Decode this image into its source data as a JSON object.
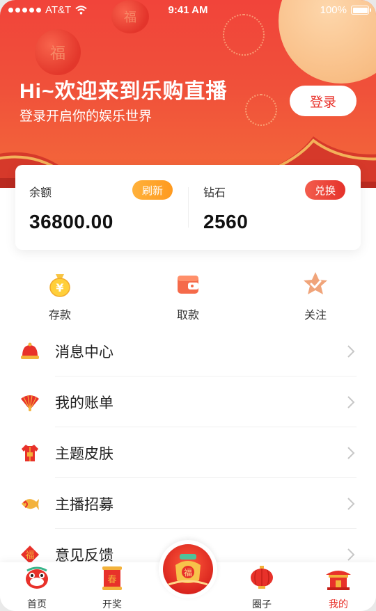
{
  "status_bar": {
    "carrier": "AT&T",
    "time": "9:41 AM",
    "battery": "100%"
  },
  "header": {
    "welcome": "Hi~欢迎来到乐购直播",
    "subtitle": "登录开启你的娱乐世界",
    "login_label": "登录"
  },
  "balance_card": {
    "balance": {
      "label": "余额",
      "value": "36800.00",
      "action": "刷新"
    },
    "diamond": {
      "label": "钻石",
      "value": "2560",
      "action": "兑换"
    }
  },
  "quick_actions": [
    {
      "label": "存款",
      "icon": "money-bag-icon"
    },
    {
      "label": "取款",
      "icon": "wallet-icon"
    },
    {
      "label": "关注",
      "icon": "star-icon"
    }
  ],
  "menu": [
    {
      "label": "消息中心",
      "icon": "helmet-icon"
    },
    {
      "label": "我的账单",
      "icon": "fan-icon"
    },
    {
      "label": "主题皮肤",
      "icon": "tang-suit-icon"
    },
    {
      "label": "主播招募",
      "icon": "fish-icon"
    },
    {
      "label": "意见反馈",
      "icon": "fu-diamond-icon"
    }
  ],
  "tabs": [
    {
      "label": "首页",
      "icon": "lion-dance-icon"
    },
    {
      "label": "开奖",
      "icon": "spring-scroll-icon"
    },
    {
      "label": "",
      "icon": "fu-bag-icon"
    },
    {
      "label": "圈子",
      "icon": "lantern-icon"
    },
    {
      "label": "我的",
      "icon": "temple-icon"
    }
  ],
  "colors": {
    "brand_red": "#e8312a",
    "orange": "#ff9a1f",
    "text": "#222222"
  }
}
